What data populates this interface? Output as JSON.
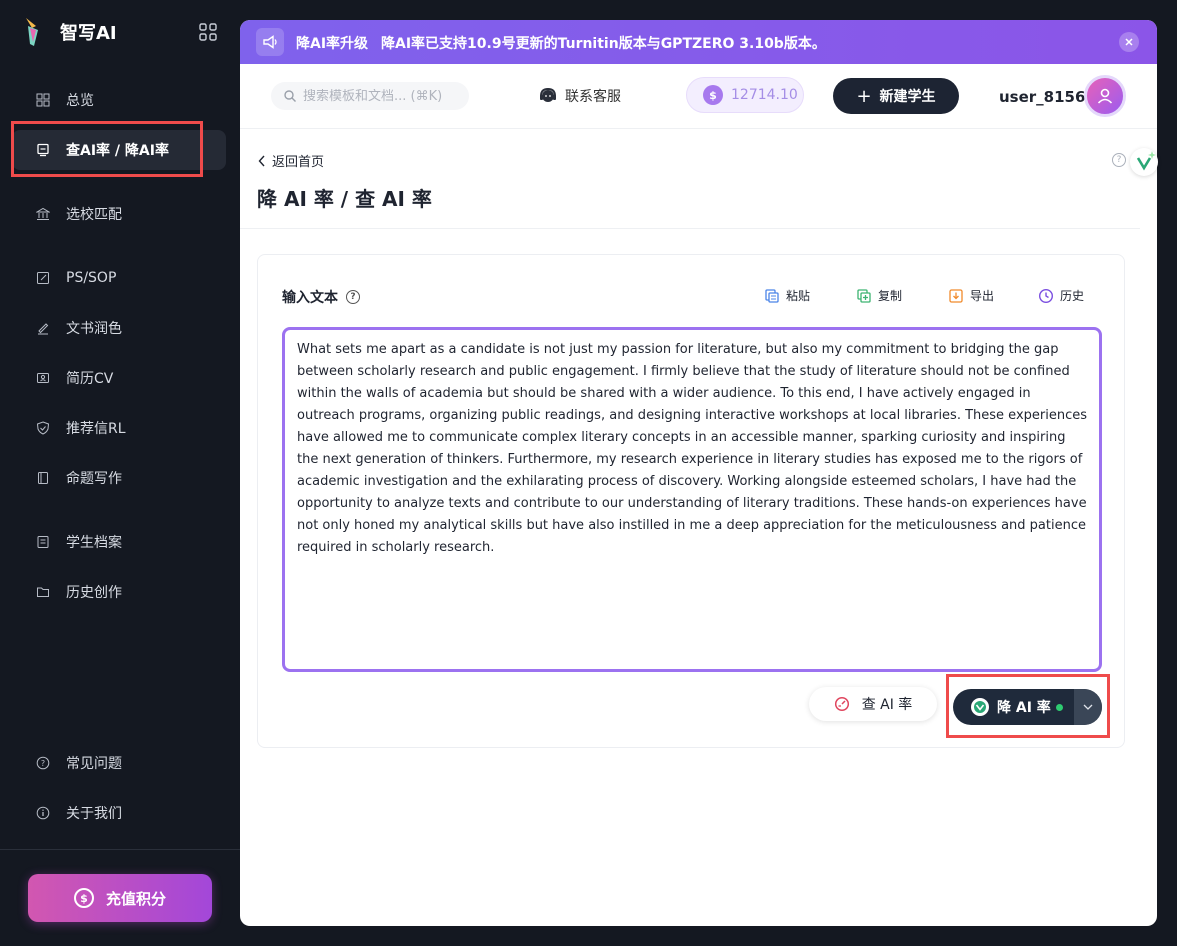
{
  "app": {
    "name": "智写AI"
  },
  "sidebar": {
    "items": [
      {
        "label": "总览",
        "icon": "grid-icon"
      },
      {
        "label": "查AI率 / 降AI率",
        "icon": "monitor-icon",
        "active": true
      },
      {
        "label": "选校匹配",
        "icon": "school-icon"
      },
      {
        "label": "PS/SOP",
        "icon": "edit-doc-icon"
      },
      {
        "label": "文书润色",
        "icon": "pen-icon"
      },
      {
        "label": "简历CV",
        "icon": "resume-icon"
      },
      {
        "label": "推荐信RL",
        "icon": "shield-icon"
      },
      {
        "label": "命题写作",
        "icon": "book-icon"
      },
      {
        "label": "学生档案",
        "icon": "archive-icon"
      },
      {
        "label": "历史创作",
        "icon": "folder-icon"
      }
    ],
    "bottom_items": [
      {
        "label": "常见问题",
        "icon": "question-icon"
      },
      {
        "label": "关于我们",
        "icon": "info-icon"
      }
    ],
    "recharge_label": "充值积分"
  },
  "banner": {
    "tag": "降AI率升级",
    "message": "降AI率已支持10.9号更新的Turnitin版本与GPTZERO 3.10b版本。"
  },
  "topbar": {
    "search_placeholder": "搜索模板和文档... (⌘K)",
    "service_label": "联系客服",
    "credits": "12714.10",
    "new_student_label": "新建学生",
    "username": "user_8156"
  },
  "page": {
    "back_label": "返回首页",
    "title": "降 AI 率 / 查 AI 率"
  },
  "editor": {
    "label": "输入文本",
    "tools": {
      "paste": "粘贴",
      "copy": "复制",
      "export": "导出",
      "history": "历史"
    },
    "text": "What sets me apart as a candidate is not just my passion for literature, but also my commitment to bridging the gap between scholarly research and public engagement. I firmly believe that the study of literature should not be confined within the walls of academia but should be shared with a wider audience. To this end, I have actively engaged in outreach programs, organizing public readings, and designing interactive workshops at local libraries. These experiences have allowed me to communicate complex literary concepts in an accessible manner, sparking curiosity and inspiring the next generation of thinkers. Furthermore, my research experience in literary studies has exposed me to the rigors of academic investigation and the exhilarating process of discovery. Working alongside esteemed scholars, I have had the opportunity to analyze texts and contribute to our understanding of literary traditions. These hands-on experiences have not only honed my analytical skills but have also instilled in me a deep appreciation for the meticulousness and patience required in scholarly research.",
    "check_label": "查 AI 率",
    "reduce_label": "降 AI 率"
  },
  "colors": {
    "accent": "#9c72f0",
    "sidebar_bg": "#141821",
    "highlight": "#ef4b4b",
    "status_dot": "#2ecc71"
  }
}
